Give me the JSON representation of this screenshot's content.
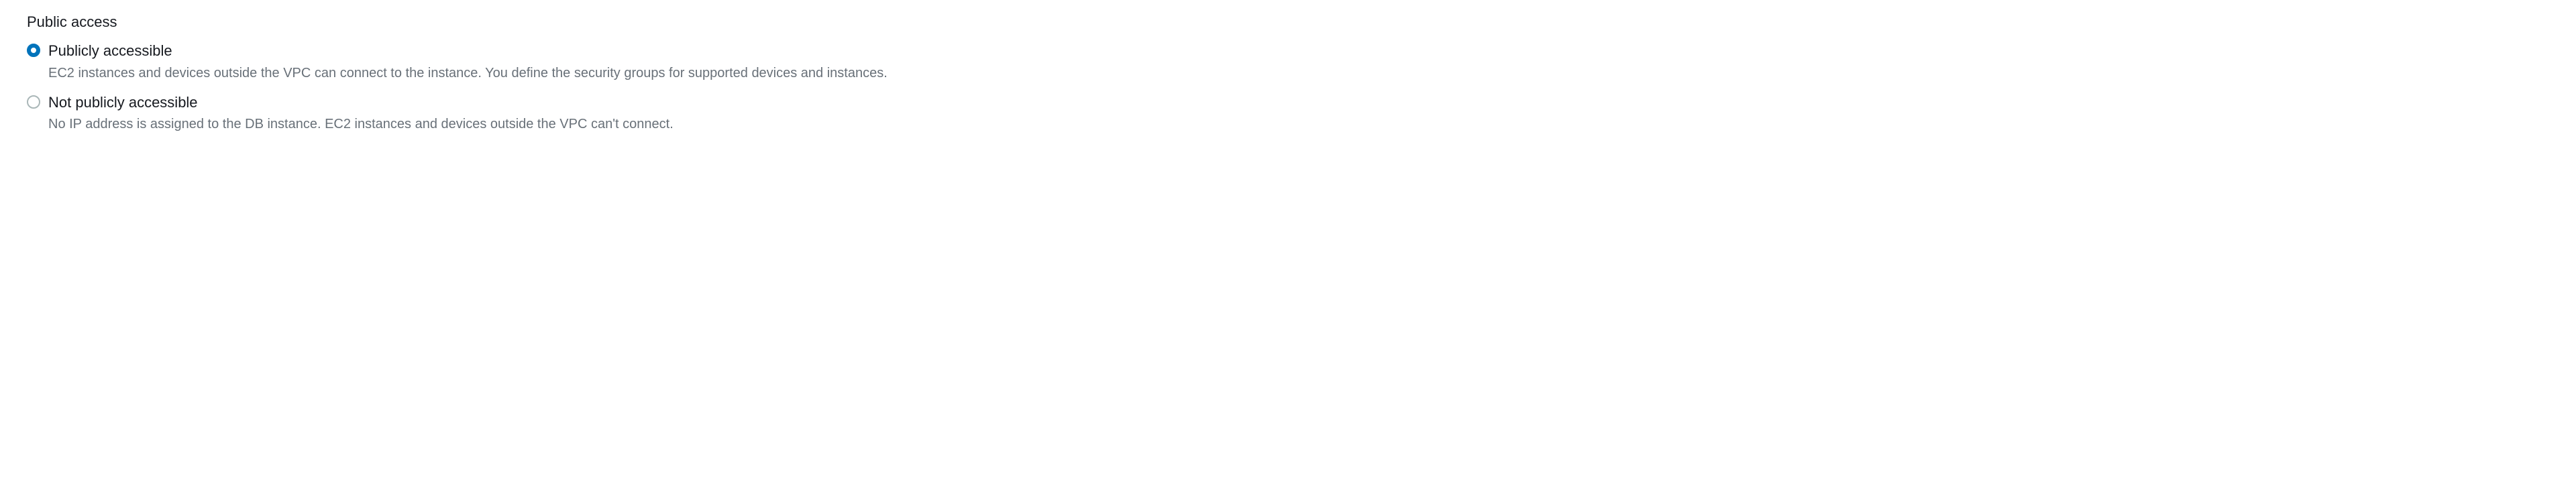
{
  "section": {
    "title": "Public access"
  },
  "options": [
    {
      "label": "Publicly accessible",
      "description": "EC2 instances and devices outside the VPC can connect to the instance. You define the security groups for supported devices and instances.",
      "selected": true
    },
    {
      "label": "Not publicly accessible",
      "description": "No IP address is assigned to the DB instance. EC2 instances and devices outside the VPC can't connect.",
      "selected": false
    }
  ]
}
